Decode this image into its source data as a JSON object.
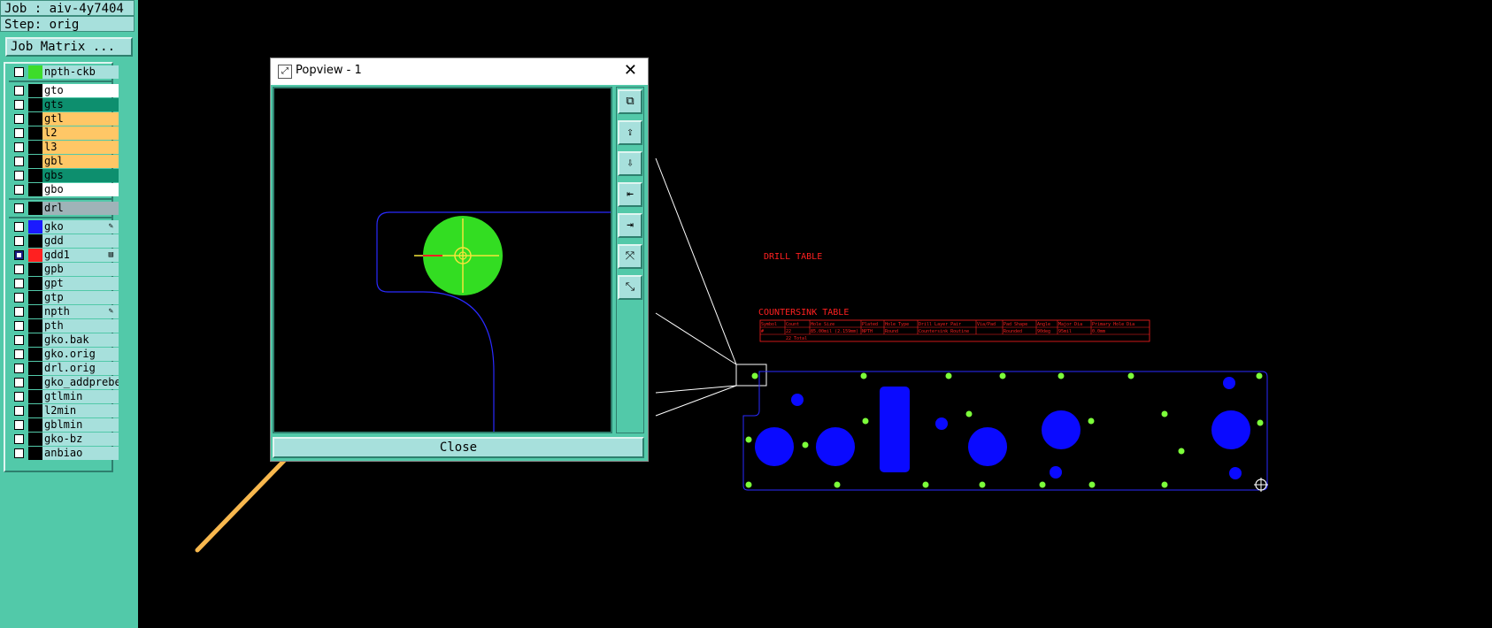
{
  "header": {
    "job": "Job : aiv-4y7404",
    "step": "Step: orig",
    "job_matrix": "Job Matrix ..."
  },
  "layers": [
    {
      "name": "npth-ckb",
      "color": "#3ddc2a",
      "bg": "#a7e0dc",
      "check": "off"
    },
    {
      "name": "gto",
      "color": "#000000",
      "bg": "#ffffff",
      "check": "off"
    },
    {
      "name": "gts",
      "color": "#000000",
      "bg": "#0d8f6e",
      "check": "off"
    },
    {
      "name": "gtl",
      "color": "#000000",
      "bg": "#ffc766",
      "check": "off"
    },
    {
      "name": "l2",
      "color": "#000000",
      "bg": "#ffc766",
      "check": "off"
    },
    {
      "name": "l3",
      "color": "#000000",
      "bg": "#ffc766",
      "check": "off"
    },
    {
      "name": "gbl",
      "color": "#000000",
      "bg": "#ffc766",
      "check": "off"
    },
    {
      "name": "gbs",
      "color": "#000000",
      "bg": "#0d8f6e",
      "check": "off"
    },
    {
      "name": "gbo",
      "color": "#000000",
      "bg": "#ffffff",
      "check": "off"
    },
    {
      "name": "drl",
      "color": "#000000",
      "bg": "#9fb3b8",
      "check": "off"
    },
    {
      "name": "gko",
      "color": "#1a1aff",
      "bg": "#a7e0dc",
      "check": "off",
      "mark": "✎"
    },
    {
      "name": "gdd",
      "color": "#000000",
      "bg": "#a7e0dc",
      "check": "off"
    },
    {
      "name": "gdd1",
      "color": "#ff2020",
      "bg": "#a7e0dc",
      "check": "sel",
      "mark": "▤"
    },
    {
      "name": "gpb",
      "color": "#000000",
      "bg": "#a7e0dc",
      "check": "off"
    },
    {
      "name": "gpt",
      "color": "#000000",
      "bg": "#a7e0dc",
      "check": "off"
    },
    {
      "name": "gtp",
      "color": "#000000",
      "bg": "#a7e0dc",
      "check": "off"
    },
    {
      "name": "npth",
      "color": "#000000",
      "bg": "#a7e0dc",
      "check": "off",
      "mark": "✎"
    },
    {
      "name": "pth",
      "color": "#000000",
      "bg": "#a7e0dc",
      "check": "off"
    },
    {
      "name": "gko.bak",
      "color": "#000000",
      "bg": "#a7e0dc",
      "check": "off"
    },
    {
      "name": "gko.orig",
      "color": "#000000",
      "bg": "#a7e0dc",
      "check": "off"
    },
    {
      "name": "drl.orig",
      "color": "#000000",
      "bg": "#a7e0dc",
      "check": "off"
    },
    {
      "name": "gko_addprebe",
      "color": "#000000",
      "bg": "#a7e0dc",
      "check": "off"
    },
    {
      "name": "gtlmin",
      "color": "#000000",
      "bg": "#a7e0dc",
      "check": "off"
    },
    {
      "name": "l2min",
      "color": "#000000",
      "bg": "#a7e0dc",
      "check": "off"
    },
    {
      "name": "gblmin",
      "color": "#000000",
      "bg": "#a7e0dc",
      "check": "off"
    },
    {
      "name": "gko-bz",
      "color": "#000000",
      "bg": "#a7e0dc",
      "check": "off"
    },
    {
      "name": "anbiao",
      "color": "#000000",
      "bg": "#a7e0dc",
      "check": "off"
    }
  ],
  "popview": {
    "title": "Popview - 1",
    "close_x": "✕",
    "close_label": "Close",
    "tools": [
      "⧉",
      "⇪",
      "⇩",
      "⇤",
      "⇥",
      "⤧",
      "⤡"
    ]
  },
  "canvas": {
    "drill_table_label": "DRILL TABLE",
    "countersink_label": "COUNTERSINK TABLE",
    "table_headers": [
      "Symbol",
      "Count",
      "Hole Size",
      "Plated",
      "Hole Type",
      "Drill Layer Pair",
      "Via/Pad",
      "Pad Shape",
      "Angle",
      "Major Dia",
      "Primary Hole Dia"
    ],
    "table_row": [
      "#",
      "22",
      "85.00mil (2.159mm)",
      "NPTH",
      "Round",
      "Countersink Routine",
      "",
      "Rounded",
      "90deg",
      "95mil",
      "0.0mm"
    ],
    "table_total": "22 Total"
  },
  "colors": {
    "panel": "#52c9a9",
    "button": "#a7e0dc",
    "board_outline": "#2a2aff",
    "hole_blue": "#0a0aff",
    "pad_green": "#7cff3a",
    "table_red": "#ff2020",
    "arrow": "#f8b84e"
  }
}
